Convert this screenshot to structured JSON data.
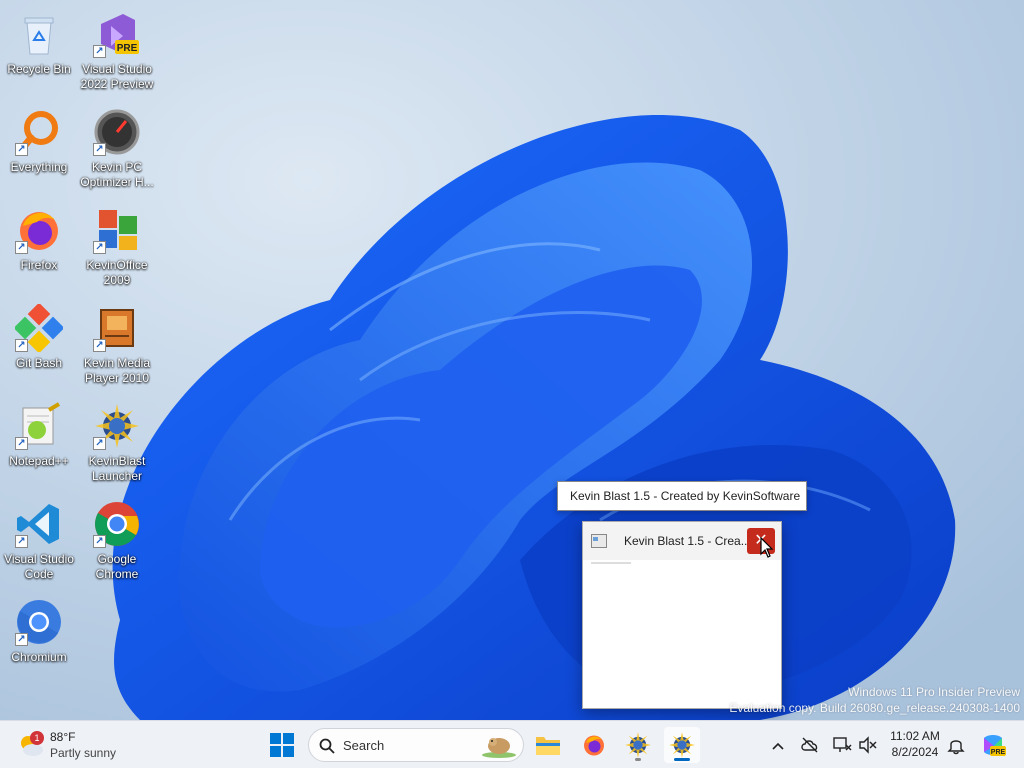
{
  "desktop": {
    "icons": [
      {
        "label": "Recycle Bin"
      },
      {
        "label": "Visual Studio 2022 Preview",
        "badge": "PRE"
      },
      {
        "label": "Everything"
      },
      {
        "label": "Kevin PC Optimizer H..."
      },
      {
        "label": "Firefox"
      },
      {
        "label": "KevinOffice 2009"
      },
      {
        "label": "Git Bash"
      },
      {
        "label": "Kevin Media Player 2010"
      },
      {
        "label": "Notepad++"
      },
      {
        "label": "KevinBlast Launcher"
      },
      {
        "label": "Visual Studio Code"
      },
      {
        "label": "Google Chrome"
      },
      {
        "label": "Chromium"
      }
    ]
  },
  "tooltip": {
    "text": "Kevin Blast 1.5 - Created by KevinSoftware"
  },
  "preview": {
    "title": "Kevin Blast 1.5 - Crea...",
    "close_glyph": "✕"
  },
  "watermark": {
    "line1": "Windows 11 Pro Insider Preview",
    "line2": "Evaluation copy. Build 26080.ge_release.240308-1400"
  },
  "taskbar": {
    "weather": {
      "temp": "88°F",
      "condition": "Partly sunny",
      "badge": "1"
    },
    "search_placeholder": "Search",
    "clock": {
      "time": "11:02 AM",
      "date": "8/2/2024"
    },
    "tray_chevron": "^"
  },
  "colors": {
    "accent": "#0067c0",
    "close_red": "#c42b1c"
  }
}
